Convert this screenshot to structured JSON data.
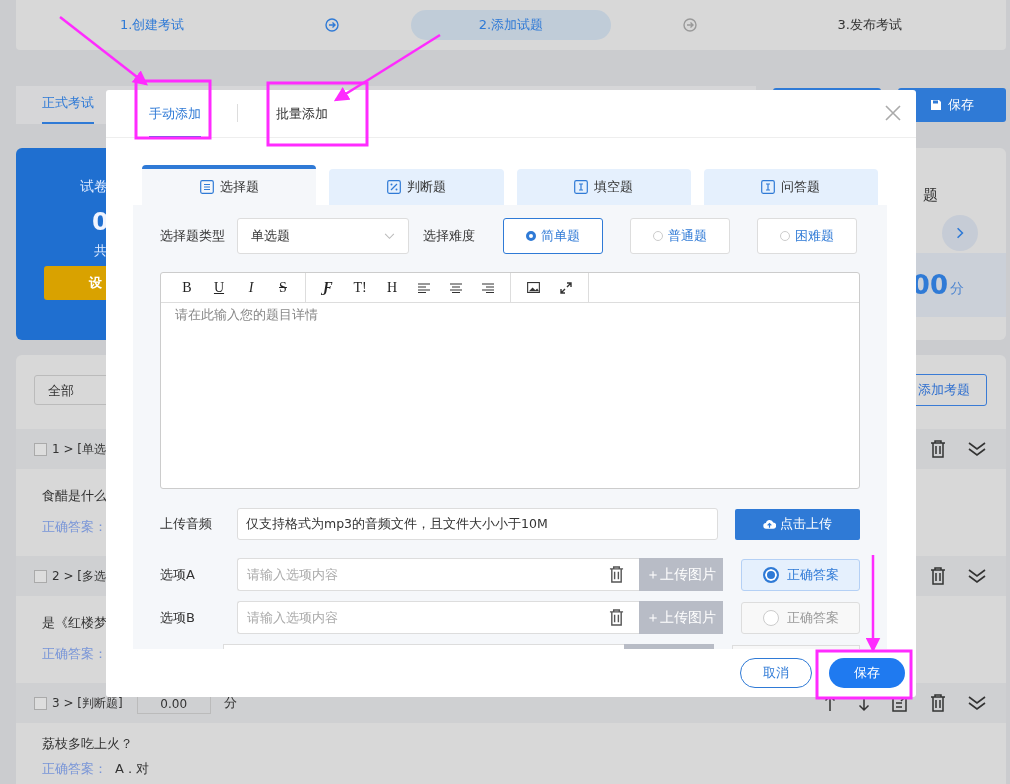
{
  "steps": [
    {
      "label": "1.创建考试",
      "selected": false
    },
    {
      "label": "2.添加试题",
      "selected": true
    },
    {
      "label": "3.发布考试",
      "selected": false
    }
  ],
  "page_tabs": [
    {
      "label": "正式考试",
      "selected": true
    }
  ],
  "save_button": {
    "label": "保存"
  },
  "summary_card": {
    "title": "试卷",
    "value": "0",
    "caption": "共",
    "button": "设"
  },
  "score_card": {
    "title": "题",
    "value": "00",
    "unit": "分"
  },
  "filter": {
    "value": "全部"
  },
  "add_question_button": {
    "label": "添加考题"
  },
  "questions": [
    {
      "header": "1 > [单选",
      "checked": false,
      "body": "食醋是什么",
      "answer_label": "正确答案："
    },
    {
      "header": "2 > [多选",
      "checked": false,
      "body": "是《红楼梦",
      "answer_label": "正确答案："
    },
    {
      "header": "3 > [判断题]",
      "checked": false,
      "score": "0.00",
      "unit": "分",
      "body": "荔枝多吃上火？",
      "answer_label": "正确答案：",
      "answer": "A . 对"
    }
  ],
  "dialog": {
    "tabs": [
      {
        "label": "手动添加",
        "selected": true
      },
      {
        "label": "批量添加",
        "selected": false
      }
    ],
    "type_tabs": [
      {
        "label": "选择题",
        "selected": true,
        "kind": "list"
      },
      {
        "label": "判断题",
        "selected": false,
        "kind": "percent"
      },
      {
        "label": "填空题",
        "selected": false,
        "kind": "text"
      },
      {
        "label": "问答题",
        "selected": false,
        "kind": "text"
      }
    ],
    "type_label": "选择题类型",
    "type_value": "单选题",
    "difficulty_label": "选择难度",
    "difficulties": [
      {
        "label": "简单题",
        "selected": true
      },
      {
        "label": "普通题",
        "selected": false
      },
      {
        "label": "困难题",
        "selected": false
      }
    ],
    "toolbar": [
      {
        "kind": "bold",
        "label": "B"
      },
      {
        "kind": "underline",
        "label": "U"
      },
      {
        "kind": "italic",
        "label": "I"
      },
      {
        "kind": "strike",
        "label": "S"
      },
      {
        "kind": "font",
        "label": "Ƒ"
      },
      {
        "kind": "size",
        "label": "T!"
      },
      {
        "kind": "heading",
        "label": "H"
      },
      {
        "kind": "align-left"
      },
      {
        "kind": "align-center"
      },
      {
        "kind": "align-right"
      },
      {
        "kind": "image"
      },
      {
        "kind": "fullscreen"
      }
    ],
    "editor_placeholder": "请在此输入您的题目详情",
    "audio_label": "上传音频",
    "audio_value": "仅支持格式为mp3的音频文件，且文件大小小于10M",
    "upload_button": "点击上传",
    "options": [
      {
        "label": "选项A",
        "placeholder": "请输入选项内容",
        "image_button": "＋上传图片",
        "answer": "正确答案",
        "selected": true
      },
      {
        "label": "选项B",
        "placeholder": "请输入选项内容",
        "image_button": "＋上传图片",
        "answer": "正确答案",
        "selected": false
      }
    ],
    "cancel_button": "取消",
    "save_button": "保存"
  }
}
